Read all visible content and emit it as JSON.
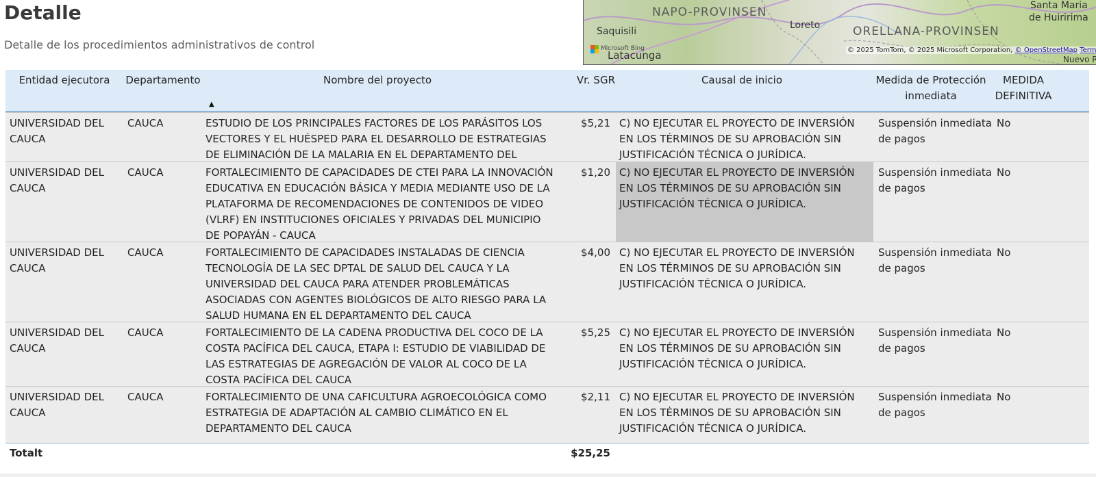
{
  "page": {
    "title": "Detalle",
    "subtitle": "Detalle de los procedimientos administrativos de control"
  },
  "map": {
    "labels": {
      "napo": "NAPO-PROVINSEN",
      "orellana": "ORELLANA-PROVINSEN",
      "saquisili": "Saquisili",
      "loreto": "Loreto",
      "latacunga": "Latacunga",
      "santa_maria": "Santa Maria",
      "huiririma": "de Huiririma",
      "nuevo": "Nuevo R"
    },
    "attribution": {
      "bing": "Microsoft Bing",
      "copyright": "© 2025 TomTom, © 2025 Microsoft Corporation,",
      "osm": "© OpenStreetMap",
      "terms": "Terms"
    }
  },
  "table": {
    "headers": {
      "entidad": "Entidad ejecutora",
      "departamento": "Departamento",
      "nombre": "Nombre del proyecto",
      "valor": "Vr. SGR",
      "causal": "Causal de inicio",
      "medida": "Medida de Protección inmediata",
      "definitiva": "MEDIDA DEFINITIVA"
    },
    "sort_indicator": "▲",
    "rows": [
      {
        "entidad": "UNIVERSIDAD DEL CAUCA",
        "departamento": "CAUCA",
        "nombre": "ESTUDIO DE LOS PRINCIPALES FACTORES DE LOS PARÁSITOS LOS VECTORES Y EL HUÉSPED PARA EL DESARROLLO DE ESTRATEGIAS DE ELIMINACIÓN DE LA MALARIA EN EL DEPARTAMENTO DEL CAUCA",
        "valor": "$5,21",
        "causal": "C) NO EJECUTAR EL PROYECTO DE INVERSIÓN EN LOS TÉRMINOS DE SU APROBACIÓN SIN JUSTIFICACIÓN TÉCNICA O JURÍDICA.",
        "medida": "Suspensión inmediata de pagos",
        "definitiva": "No"
      },
      {
        "entidad": "UNIVERSIDAD DEL CAUCA",
        "departamento": "CAUCA",
        "nombre": "FORTALECIMIENTO DE CAPACIDADES DE CTEI PARA LA INNOVACIÓN EDUCATIVA EN EDUCACIÓN BÁSICA Y MEDIA MEDIANTE USO DE LA PLATAFORMA DE RECOMENDACIONES DE CONTENIDOS DE VIDEO (VLRF) EN INSTITUCIONES OFICIALES Y PRIVADAS DEL MUNICIPIO DE POPAYÁN - CAUCA",
        "valor": "$1,20",
        "causal": "C) NO EJECUTAR EL PROYECTO DE INVERSIÓN EN LOS TÉRMINOS DE SU APROBACIÓN SIN JUSTIFICACIÓN TÉCNICA O JURÍDICA.",
        "medida": "Suspensión inmediata de pagos",
        "definitiva": "No"
      },
      {
        "entidad": "UNIVERSIDAD DEL CAUCA",
        "departamento": "CAUCA",
        "nombre": "FORTALECIMIENTO DE CAPACIDADES INSTALADAS DE CIENCIA TECNOLOGÍA DE LA SEC DPTAL DE SALUD DEL CAUCA Y LA UNIVERSIDAD DEL CAUCA PARA ATENDER PROBLEMÁTICAS ASOCIADAS CON AGENTES BIOLÓGICOS DE ALTO RIESGO PARA LA SALUD HUMANA EN EL DEPARTAMENTO DEL CAUCA",
        "valor": "$4,00",
        "causal": "C) NO EJECUTAR EL PROYECTO DE INVERSIÓN EN LOS TÉRMINOS DE SU APROBACIÓN SIN JUSTIFICACIÓN TÉCNICA O JURÍDICA.",
        "medida": "Suspensión inmediata de pagos",
        "definitiva": "No"
      },
      {
        "entidad": "UNIVERSIDAD DEL CAUCA",
        "departamento": "CAUCA",
        "nombre": "FORTALECIMIENTO DE LA CADENA PRODUCTIVA DEL COCO DE LA COSTA PACÍFICA DEL CAUCA, ETAPA I: ESTUDIO DE VIABILIDAD DE LAS ESTRATEGIAS DE AGREGACIÓN DE VALOR AL COCO DE LA COSTA PACÍFICA DEL CAUCA",
        "valor": "$5,25",
        "causal": "C) NO EJECUTAR EL PROYECTO DE INVERSIÓN EN LOS TÉRMINOS DE SU APROBACIÓN SIN JUSTIFICACIÓN TÉCNICA O JURÍDICA.",
        "medida": "Suspensión inmediata de pagos",
        "definitiva": "No"
      },
      {
        "entidad": "UNIVERSIDAD DEL CAUCA",
        "departamento": "CAUCA",
        "nombre": "FORTALECIMIENTO DE UNA CAFICULTURA AGROECOLÓGICA COMO ESTRATEGIA DE ADAPTACIÓN AL CAMBIO CLIMÁTICO EN EL DEPARTAMENTO DEL CAUCA",
        "valor": "$2,11",
        "causal": "C) NO EJECUTAR EL PROYECTO DE INVERSIÓN EN LOS TÉRMINOS DE SU APROBACIÓN SIN JUSTIFICACIÓN TÉCNICA O JURÍDICA.",
        "medida": "Suspensión inmediata de pagos",
        "definitiva": "No"
      }
    ],
    "total": {
      "label": "Totalt",
      "valor": "$25,25"
    }
  }
}
